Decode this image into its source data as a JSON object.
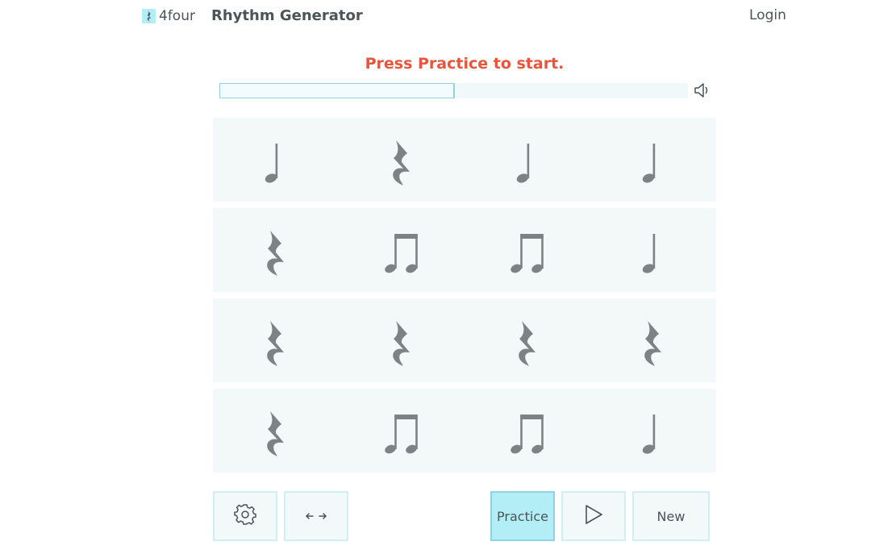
{
  "header": {
    "logo_text": "4four",
    "app_title": "Rhythm Generator",
    "login_label": "Login"
  },
  "status": {
    "message": "Press Practice to start.",
    "color": "#e9553a"
  },
  "progress": {
    "value": 0.5
  },
  "icons": {
    "logo": "quarter-rest-icon",
    "volume": "speaker-icon",
    "settings": "gear-icon",
    "arrows": "left-right-arrow-icon",
    "play": "play-icon"
  },
  "measures": [
    [
      "quarter-note",
      "quarter-rest",
      "quarter-note",
      "quarter-note"
    ],
    [
      "quarter-rest",
      "eighth-pair",
      "eighth-pair",
      "quarter-note"
    ],
    [
      "quarter-rest",
      "quarter-rest",
      "quarter-rest",
      "quarter-rest"
    ],
    [
      "quarter-rest",
      "eighth-pair",
      "eighth-pair",
      "quarter-note"
    ]
  ],
  "controls": {
    "practice_label": "Practice",
    "new_label": "New"
  },
  "colors": {
    "accent": "#b3eef7",
    "accent_border": "#8ed3e2",
    "panel": "#f3f8f9",
    "notation": "#7d8285"
  }
}
